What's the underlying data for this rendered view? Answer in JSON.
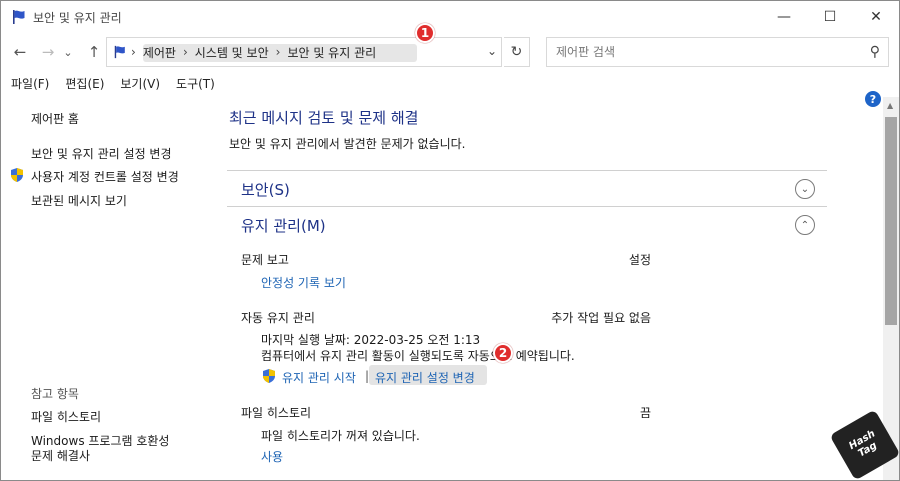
{
  "window": {
    "title": "보안 및 유지 관리",
    "controls": {
      "minimize": "—",
      "maximize": "☐",
      "close": "✕"
    }
  },
  "nav": {
    "back": "←",
    "forward": "→",
    "recent": "⌄",
    "up": "↑",
    "breadcrumbs": [
      "제어판",
      "시스템 및 보안",
      "보안 및 유지 관리"
    ],
    "separator": "›",
    "dropdown": "⌄",
    "refresh": "↻",
    "search_placeholder": "제어판 검색",
    "search_icon": "⚲"
  },
  "menubar": [
    "파일(F)",
    "편집(E)",
    "보기(V)",
    "도구(T)"
  ],
  "sidebar": {
    "items": [
      "제어판 홈",
      "보안 및 유지 관리 설정 변경",
      "사용자 계정 컨트롤 설정 변경",
      "보관된 메시지 보기"
    ],
    "see_also_title": "참고 항목",
    "see_also": [
      "파일 히스토리",
      "Windows 프로그램 호환성",
      "문제 해결사"
    ]
  },
  "main": {
    "heading": "최근 메시지 검토 및 문제 해결",
    "subheading": "보안 및 유지 관리에서 발견한 문제가 없습니다.",
    "security": {
      "label": "보안(S)",
      "chevron": "⌄"
    },
    "maintenance": {
      "label": "유지 관리(M)",
      "chevron": "⌃",
      "problem_report": {
        "label": "문제 보고",
        "status": "설정",
        "link": "안정성 기록 보기"
      },
      "auto_maintenance": {
        "label": "자동 유지 관리",
        "status": "추가 작업 필요 없음",
        "last_run": "마지막 실행 날짜: 2022-03-25 오전 1:13",
        "schedule_note": "컴퓨터에서 유지 관리 활동이 실행되도록 자동으로 예약됩니다.",
        "start_link": "유지 관리 시작",
        "divider": "|",
        "settings_link": "유지 관리 설정 변경"
      },
      "file_history": {
        "label": "파일 히스토리",
        "status": "끔",
        "note": "파일 히스토리가 꺼져 있습니다.",
        "link": "사용"
      }
    }
  },
  "help_icon": "?",
  "annotations": {
    "badge1": "1",
    "badge2": "2"
  },
  "watermark": [
    "Hash",
    "Tag"
  ]
}
